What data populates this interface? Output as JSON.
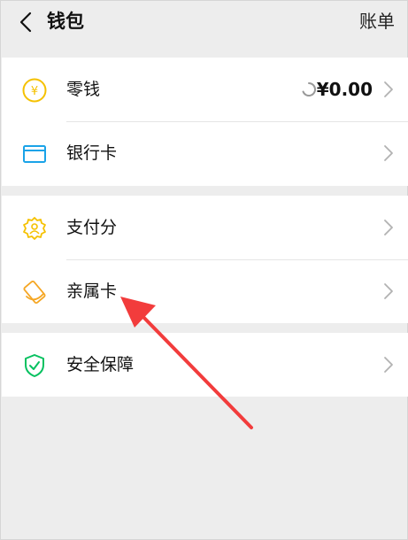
{
  "header": {
    "title": "钱包",
    "bill_label": "账单"
  },
  "groups": [
    {
      "items": [
        {
          "label": "零钱",
          "icon": "coin-icon",
          "value": "¥0.00",
          "icon_color": "#f5c100"
        },
        {
          "label": "银行卡",
          "icon": "bank-card-icon",
          "icon_color": "#1aa3e8"
        }
      ]
    },
    {
      "items": [
        {
          "label": "支付分",
          "icon": "pay-score-icon",
          "icon_color": "#f5c100"
        },
        {
          "label": "亲属卡",
          "icon": "family-card-icon",
          "icon_color": "#f5a623"
        }
      ]
    },
    {
      "items": [
        {
          "label": "安全保障",
          "icon": "shield-check-icon",
          "icon_color": "#07c160"
        }
      ]
    }
  ],
  "colors": {
    "background": "#ededed",
    "annotation_arrow": "#f23c3c"
  }
}
